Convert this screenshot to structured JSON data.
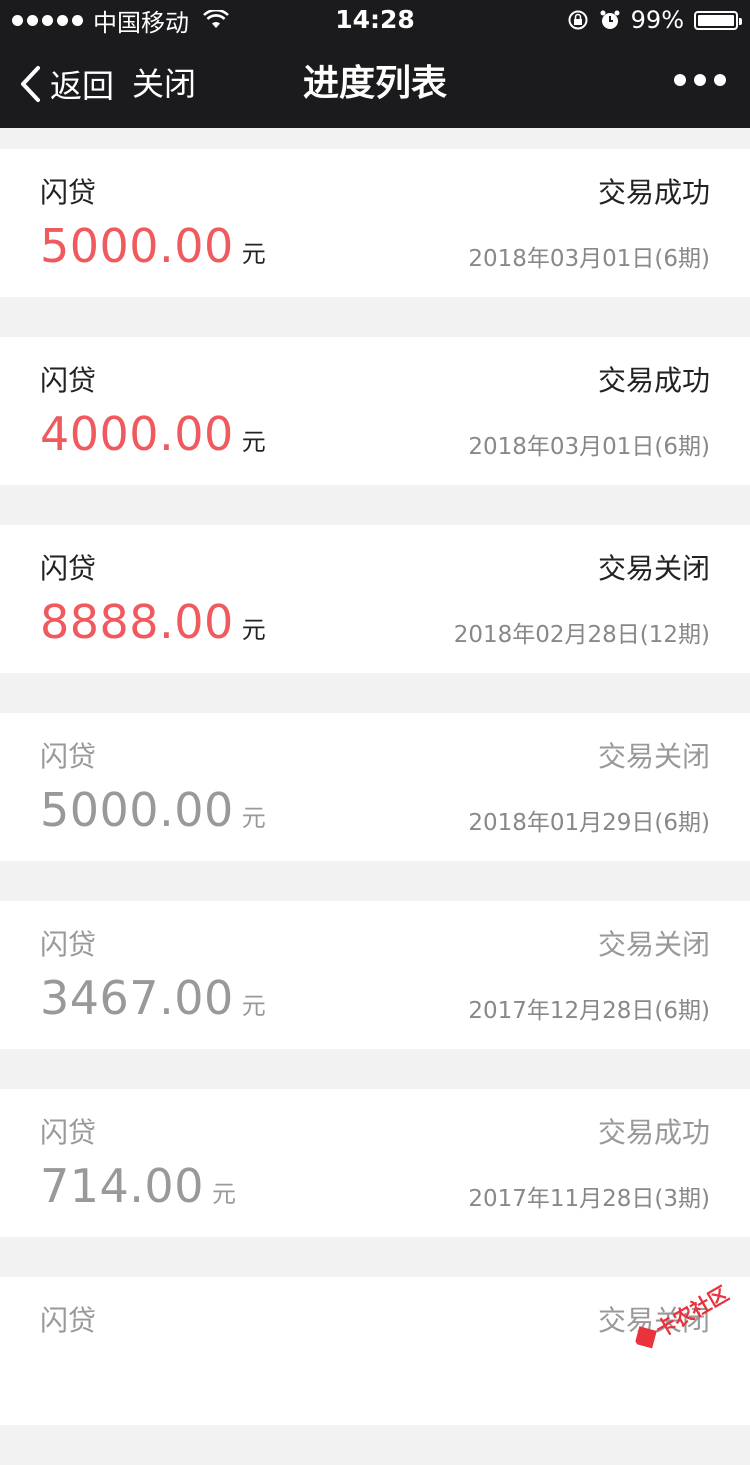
{
  "status_bar": {
    "carrier": "中国移动",
    "time": "14:28",
    "battery_percent": "99%",
    "battery_level": 0.99
  },
  "nav": {
    "back_label": "返回",
    "close_label": "关闭",
    "title": "进度列表"
  },
  "loans": [
    {
      "name": "闪贷",
      "status": "交易成功",
      "amount": "5000.00",
      "unit": "元",
      "date": "2018年03月01日(6期)",
      "active": true
    },
    {
      "name": "闪贷",
      "status": "交易成功",
      "amount": "4000.00",
      "unit": "元",
      "date": "2018年03月01日(6期)",
      "active": true
    },
    {
      "name": "闪贷",
      "status": "交易关闭",
      "amount": "8888.00",
      "unit": "元",
      "date": "2018年02月28日(12期)",
      "active": true
    },
    {
      "name": "闪贷",
      "status": "交易关闭",
      "amount": "5000.00",
      "unit": "元",
      "date": "2018年01月29日(6期)",
      "active": false
    },
    {
      "name": "闪贷",
      "status": "交易关闭",
      "amount": "3467.00",
      "unit": "元",
      "date": "2017年12月28日(6期)",
      "active": false
    },
    {
      "name": "闪贷",
      "status": "交易成功",
      "amount": "714.00",
      "unit": "元",
      "date": "2017年11月28日(3期)",
      "active": false
    },
    {
      "name": "闪贷",
      "status": "交易关闭",
      "amount": "",
      "unit": "",
      "date": "",
      "active": false
    }
  ],
  "watermark": {
    "text": "卡农社区",
    "color": "#e8323c"
  },
  "colors": {
    "bar": "#1b1b1d",
    "amount_active": "#f05a5f",
    "amount_inactive": "#999999",
    "background": "#f2f2f2"
  }
}
